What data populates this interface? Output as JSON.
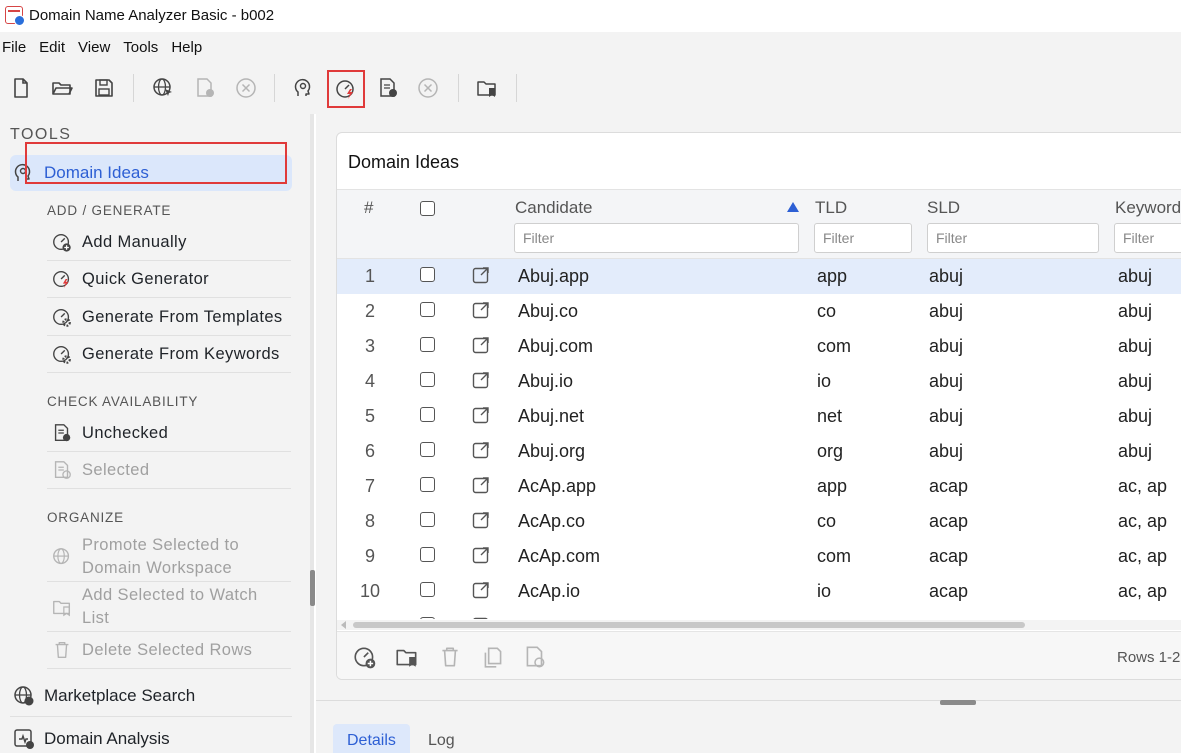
{
  "window": {
    "title": "Domain Name Analyzer Basic - b002"
  },
  "menu": [
    "File",
    "Edit",
    "View",
    "Tools",
    "Help"
  ],
  "toolbar": {
    "buttons": [
      {
        "name": "new-file-icon",
        "enabled": true
      },
      {
        "name": "open-folder-icon",
        "enabled": true
      },
      {
        "name": "save-icon",
        "enabled": true
      },
      {
        "name": "globe-cursor-icon",
        "enabled": true
      },
      {
        "name": "doc-check-icon",
        "enabled": false
      },
      {
        "name": "cancel-icon",
        "enabled": false
      },
      {
        "name": "head-gear-icon",
        "enabled": true
      },
      {
        "name": "quick-generator-icon",
        "enabled": true,
        "highlighted": true
      },
      {
        "name": "doc-check-dark-icon",
        "enabled": true
      },
      {
        "name": "cancel-icon-2",
        "enabled": false
      },
      {
        "name": "watch-list-folder-icon",
        "enabled": true
      }
    ]
  },
  "sidebar": {
    "tools_title": "TOOLS",
    "domain_ideas": "Domain Ideas",
    "sections": {
      "add_generate": "ADD / GENERATE",
      "check_availability": "CHECK AVAILABILITY",
      "organize": "ORGANIZE"
    },
    "add_items": {
      "add_manually": "Add Manually",
      "quick_generator": "Quick Generator",
      "from_templates": "Generate From Templates",
      "from_keywords": "Generate From Keywords"
    },
    "check_items": {
      "unchecked": "Unchecked",
      "selected": "Selected"
    },
    "organize_items": {
      "promote_1": "Promote Selected to",
      "promote_2": "Domain Workspace",
      "watch_1": "Add Selected to Watch",
      "watch_2": "List",
      "delete": "Delete Selected Rows"
    },
    "marketplace_search": "Marketplace Search",
    "domain_analysis": "Domain Analysis"
  },
  "panel": {
    "title": "Domain Ideas",
    "columns": {
      "num": "#",
      "candidate": "Candidate",
      "tld": "TLD",
      "sld": "SLD",
      "keywords": "Keyword"
    },
    "filter_placeholder": "Filter",
    "sort": {
      "column": "Candidate",
      "direction": "ascending"
    },
    "rows": [
      {
        "num": "1",
        "candidate": "Abuj.app",
        "tld": "app",
        "sld": "abuj",
        "keywords": "abuj",
        "selected": true
      },
      {
        "num": "2",
        "candidate": "Abuj.co",
        "tld": "co",
        "sld": "abuj",
        "keywords": "abuj"
      },
      {
        "num": "3",
        "candidate": "Abuj.com",
        "tld": "com",
        "sld": "abuj",
        "keywords": "abuj"
      },
      {
        "num": "4",
        "candidate": "Abuj.io",
        "tld": "io",
        "sld": "abuj",
        "keywords": "abuj"
      },
      {
        "num": "5",
        "candidate": "Abuj.net",
        "tld": "net",
        "sld": "abuj",
        "keywords": "abuj"
      },
      {
        "num": "6",
        "candidate": "Abuj.org",
        "tld": "org",
        "sld": "abuj",
        "keywords": "abuj"
      },
      {
        "num": "7",
        "candidate": "AcAp.app",
        "tld": "app",
        "sld": "acap",
        "keywords": "ac, ap"
      },
      {
        "num": "8",
        "candidate": "AcAp.co",
        "tld": "co",
        "sld": "acap",
        "keywords": "ac, ap"
      },
      {
        "num": "9",
        "candidate": "AcAp.com",
        "tld": "com",
        "sld": "acap",
        "keywords": "ac, ap"
      },
      {
        "num": "10",
        "candidate": "AcAp.io",
        "tld": "io",
        "sld": "acap",
        "keywords": "ac, ap"
      }
    ],
    "rows_info": "Rows 1-2"
  },
  "bottom_tabs": {
    "details": "Details",
    "log": "Log"
  },
  "colors": {
    "accent": "#2d5fd4",
    "highlight": "#e03a3a",
    "selected_row": "#e3ecfb"
  }
}
